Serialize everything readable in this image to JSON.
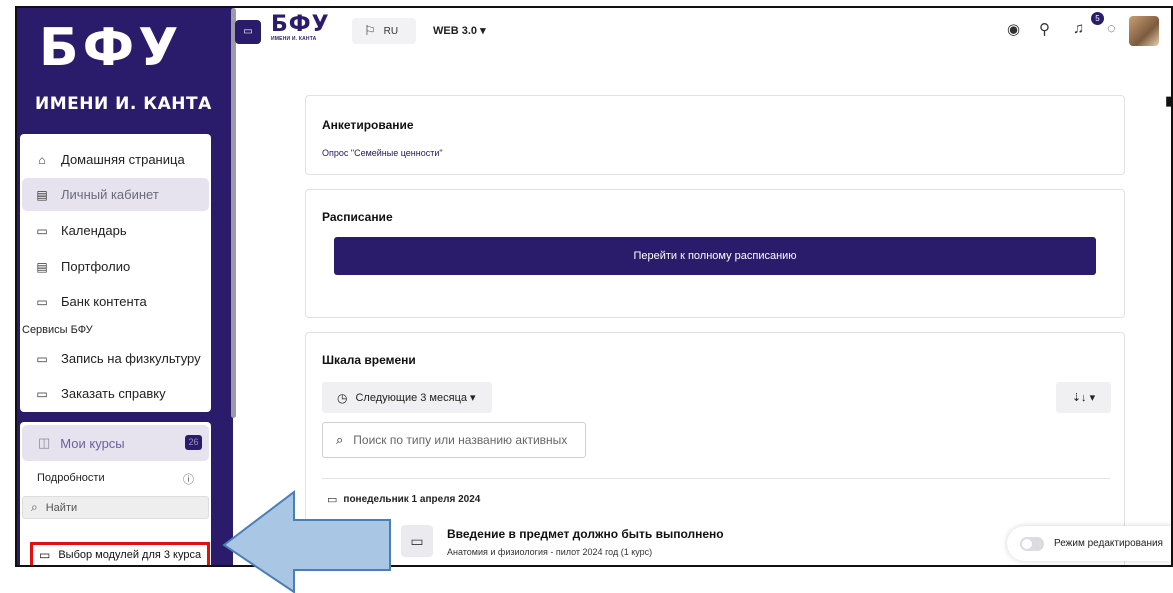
{
  "brand": {
    "logo_big": "БФУ",
    "logo_sub": "ИМЕНИ И. КАНТА",
    "top_logo_big": "БФУ",
    "top_logo_small": "ИМЕНИ И. КАНТА"
  },
  "sidebar": {
    "items": [
      {
        "label": "Домашняя страница",
        "icon": "home-icon",
        "active": false
      },
      {
        "label": "Личный кабинет",
        "icon": "dashboard-icon",
        "active": true
      },
      {
        "label": "Календарь",
        "icon": "calendar-icon",
        "active": false
      },
      {
        "label": "Портфолио",
        "icon": "portfolio-icon",
        "active": false
      },
      {
        "label": "Банк контента",
        "icon": "folder-icon",
        "active": false
      }
    ],
    "section_label": "Сервисы БФУ",
    "service_items": [
      {
        "label": "Запись на физкультуру",
        "icon": "folder-icon"
      },
      {
        "label": "Заказать справку",
        "icon": "folder-icon"
      }
    ],
    "courses": {
      "label": "Мои курсы",
      "badge": "26",
      "details": "Подробности",
      "search_placeholder": "Найти",
      "highlighted_module": "Выбор модулей для 3 курса"
    }
  },
  "topbar": {
    "language": "RU",
    "version": "WEB 3.0 ▾",
    "notifications_count": "5"
  },
  "surveys": {
    "title": "Анкетирование",
    "link": "Опрос \"Семейные ценности\""
  },
  "schedule": {
    "title": "Расписание",
    "button": "Перейти к полному расписанию"
  },
  "timeline": {
    "title": "Шкала времени",
    "filter": "Следующие 3 месяца ▾",
    "sort": "⇣↓ ▾",
    "search_placeholder": "Поиск по типу или названию активных",
    "date": "понедельник 1 апреля 2024",
    "event_title": "Введение в предмет должно быть выполнено",
    "event_course": "Анатомия и физиология - пилот 2024 год (1 курс)"
  },
  "edit_mode": {
    "label": "Режим редактирования"
  },
  "colors": {
    "brand": "#2b1c6b",
    "highlight_border": "#e01010",
    "arrow_fill": "#a9c6e4"
  }
}
